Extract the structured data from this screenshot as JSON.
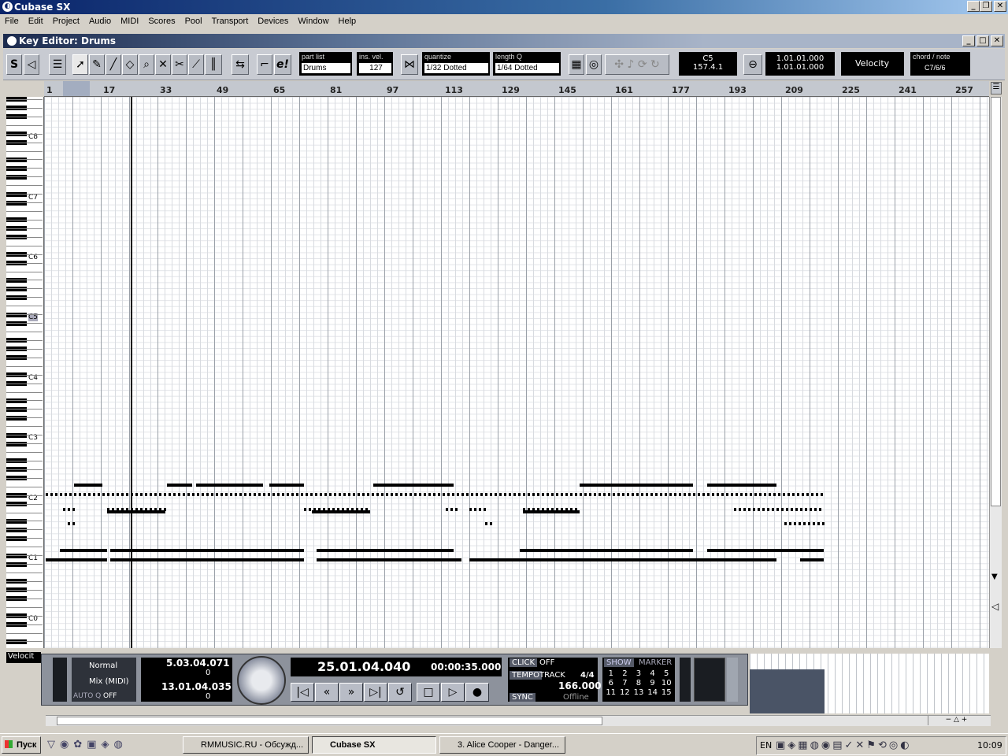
{
  "app": {
    "title": "Cubase SX"
  },
  "menu": [
    "File",
    "Edit",
    "Project",
    "Audio",
    "MIDI",
    "Scores",
    "Pool",
    "Transport",
    "Devices",
    "Window",
    "Help"
  ],
  "editor": {
    "title": "Key Editor: Drums"
  },
  "toolbar": {
    "solo_label": "S",
    "part_list": {
      "label": "part list",
      "value": "Drums"
    },
    "ins_vel": {
      "label": "ins. vel.",
      "value": "127"
    },
    "quantize": {
      "label": "quantize",
      "value": "1/32 Dotted"
    },
    "length_q": {
      "label": "length Q",
      "value": "1/64 Dotted"
    },
    "mouse_note": "C5",
    "mouse_pos": "157.4.1",
    "pos_top": "1.01.01.000",
    "pos_bottom": "1.01.01.000",
    "controller": "Velocity",
    "chord_label": "chord / note",
    "chord_value": "C7/6/6"
  },
  "ruler": [
    "1",
    "17",
    "33",
    "49",
    "65",
    "81",
    "97",
    "113",
    "129",
    "145",
    "161",
    "177",
    "193",
    "209",
    "225",
    "241",
    "257"
  ],
  "keys": [
    "C8",
    "C7",
    "C6",
    "C5",
    "C4",
    "C3",
    "C2",
    "C1",
    "C0"
  ],
  "lane_select": "Velocit",
  "transport": {
    "mode": "Normal",
    "mix": "Mix (MIDI)",
    "autoq_label": "AUTO Q",
    "autoq_value": "OFF",
    "left_locator": "5.03.04.071",
    "left_sub": "0",
    "right_locator": "13.01.04.035",
    "right_sub": "0",
    "position": "25.01.04.040",
    "time": "00:00:35.000",
    "click_label": "CLICK",
    "click_value": "OFF",
    "tempo_label": "TEMPO",
    "tempo_mode": "TRACK",
    "signature": "4/4",
    "tempo_value": "166.000",
    "sync_label": "SYNC",
    "sync_value": "Offline",
    "show_label": "SHOW",
    "marker_label": "MARKER",
    "markers": [
      "1",
      "2",
      "3",
      "4",
      "5",
      "6",
      "7",
      "8",
      "9",
      "10",
      "11",
      "12",
      "13",
      "14",
      "15"
    ]
  },
  "taskbar": {
    "start": "Пуск",
    "tasks": [
      "RMMUSIC.RU - Обсужд...",
      "Cubase SX",
      "3. Alice Cooper - Danger..."
    ],
    "lang": "EN",
    "clock": "10:09"
  }
}
